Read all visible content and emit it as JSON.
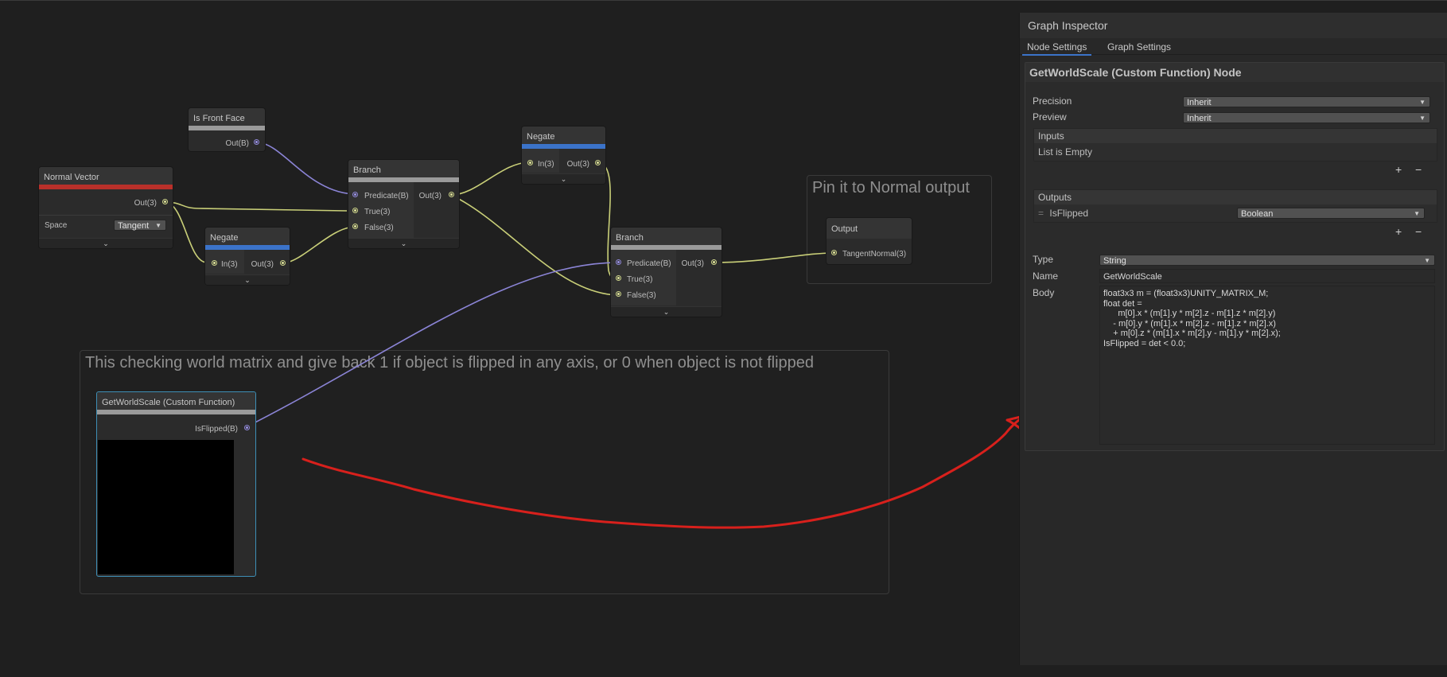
{
  "canvas": {
    "groups": [
      {
        "title": "Pin it to Normal output"
      },
      {
        "title": "This checking world matrix and give back 1 if object is flipped in any axis, or 0 when object is not flipped"
      }
    ],
    "nodes": {
      "is_front_face": {
        "title": "Is Front Face",
        "out": "Out(B)"
      },
      "normal_vector": {
        "title": "Normal Vector",
        "out": "Out(3)",
        "space_label": "Space",
        "space_value": "Tangent"
      },
      "negate_bottom": {
        "title": "Negate",
        "in": "In(3)",
        "out": "Out(3)"
      },
      "branch_left": {
        "title": "Branch",
        "predicate": "Predicate(B)",
        "true": "True(3)",
        "false": "False(3)",
        "out": "Out(3)"
      },
      "negate_top": {
        "title": "Negate",
        "in": "In(3)",
        "out": "Out(3)"
      },
      "branch_right": {
        "title": "Branch",
        "predicate": "Predicate(B)",
        "true": "True(3)",
        "false": "False(3)",
        "out": "Out(3)"
      },
      "output": {
        "title": "Output",
        "in": "TangentNormal(3)"
      },
      "custom_function": {
        "title": "GetWorldScale (Custom Function)",
        "out": "IsFlipped(B)"
      }
    },
    "colors": {
      "annotation_stroke": "#d8201c",
      "vector_wire": "#c9cf78",
      "bool_wire": "#8b84d6",
      "accent_blue": "#3b73c9",
      "accent_red": "#b9302a"
    }
  },
  "inspector": {
    "title": "Graph Inspector",
    "tabs": [
      "Node Settings",
      "Graph Settings"
    ],
    "panel_title": "GetWorldScale (Custom Function) Node",
    "precision": {
      "label": "Precision",
      "value": "Inherit"
    },
    "preview": {
      "label": "Preview",
      "value": "Inherit"
    },
    "inputs": {
      "header": "Inputs",
      "empty_text": "List is Empty"
    },
    "outputs": {
      "header": "Outputs",
      "item_name": "IsFlipped",
      "item_type": "Boolean"
    },
    "type": {
      "label": "Type",
      "value": "String"
    },
    "name": {
      "label": "Name",
      "value": "GetWorldScale"
    },
    "body": {
      "label": "Body",
      "lines": [
        "float3x3 m = (float3x3)UNITY_MATRIX_M;",
        "float det =",
        "      m[0].x * (m[1].y * m[2].z - m[1].z * m[2].y)",
        "    - m[0].y * (m[1].x * m[2].z - m[1].z * m[2].x)",
        "    + m[0].z * (m[1].x * m[2].y - m[1].y * m[2].x);",
        "",
        "IsFlipped = det < 0.0;"
      ]
    },
    "icons": {
      "add": "plus-icon",
      "remove": "minus-icon",
      "chevron": "chevron-down-icon",
      "drag": "drag-handle-icon"
    }
  }
}
